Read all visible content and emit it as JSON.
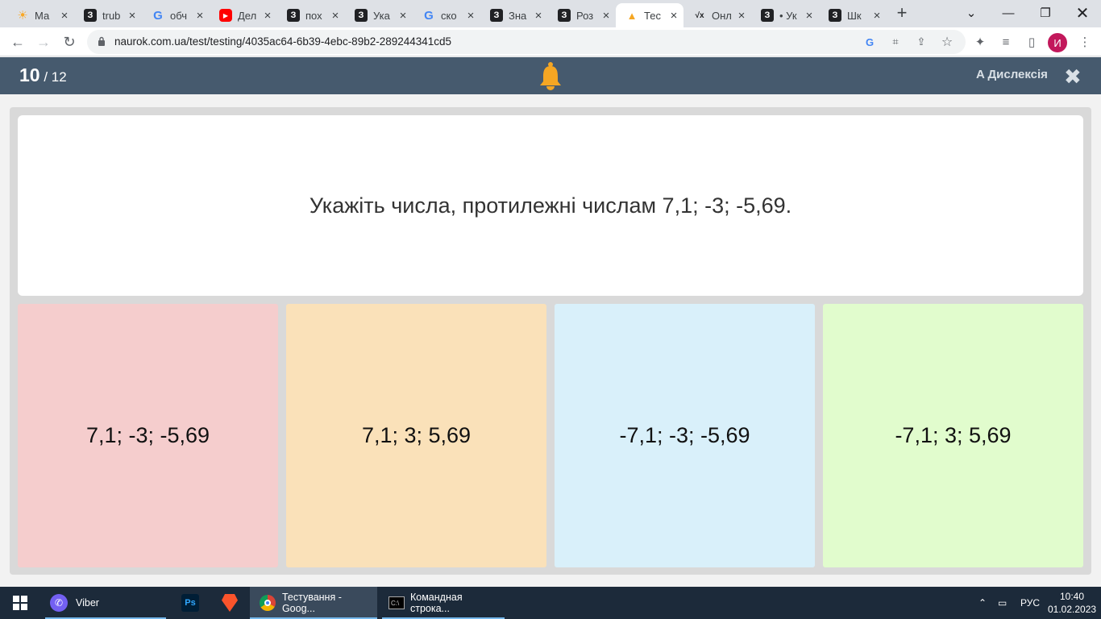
{
  "browser": {
    "tabs": [
      {
        "label": "Ма",
        "icon": "sun-favicon-icon",
        "color": "#f9a825"
      },
      {
        "label": "trub",
        "icon": "naurok-favicon-icon",
        "color": "#202124"
      },
      {
        "label": "обч",
        "icon": "google-favicon-icon",
        "color": "#4285f4"
      },
      {
        "label": "Дел",
        "icon": "youtube-favicon-icon",
        "color": "#ff0000"
      },
      {
        "label": "пох",
        "icon": "naurok-favicon-icon",
        "color": "#202124"
      },
      {
        "label": "Ука",
        "icon": "naurok-favicon-icon",
        "color": "#202124"
      },
      {
        "label": "ско",
        "icon": "google-favicon-icon",
        "color": "#4285f4"
      },
      {
        "label": "Зна",
        "icon": "naurok-favicon-icon",
        "color": "#202124"
      },
      {
        "label": "Роз",
        "icon": "naurok-favicon-icon",
        "color": "#202124"
      },
      {
        "label": "Тес",
        "icon": "bell-favicon-icon",
        "color": "#f5a623",
        "active": true
      },
      {
        "label": "Онл",
        "icon": "math-favicon-icon",
        "color": "#202124"
      },
      {
        "label": "• Ук",
        "icon": "naurok-favicon-icon",
        "color": "#202124"
      },
      {
        "label": "Шк",
        "icon": "naurok-favicon-icon",
        "color": "#202124"
      }
    ],
    "url": "naurok.com.ua/test/testing/4035ac64-6b39-4ebc-89b2-289244341cd5",
    "profile_initial": "И"
  },
  "app": {
    "progress_current": "10",
    "progress_total": "/ 12",
    "dyslexia_label": "A Дислексія",
    "header_color": "#465a6e",
    "bell_color": "#f5a623"
  },
  "question": {
    "text": "Укажіть числа, протилежні числам 7,1; -3; -5,69."
  },
  "options": [
    {
      "text": "7,1; -3; -5,69",
      "color": "#f5cdcd"
    },
    {
      "text": "7,1; 3; 5,69",
      "color": "#fae1b9"
    },
    {
      "text": "-7,1; -3; -5,69",
      "color": "#d9f0fa"
    },
    {
      "text": "-7,1; 3; 5,69",
      "color": "#e1fccd"
    }
  ],
  "taskbar": {
    "items": [
      {
        "label": "Viber"
      },
      {
        "label": ""
      },
      {
        "label": ""
      },
      {
        "label": "Тестування - Goog..."
      },
      {
        "label": "Командная строка..."
      }
    ],
    "language": "РУС",
    "time": "10:40",
    "date": "01.02.2023"
  }
}
